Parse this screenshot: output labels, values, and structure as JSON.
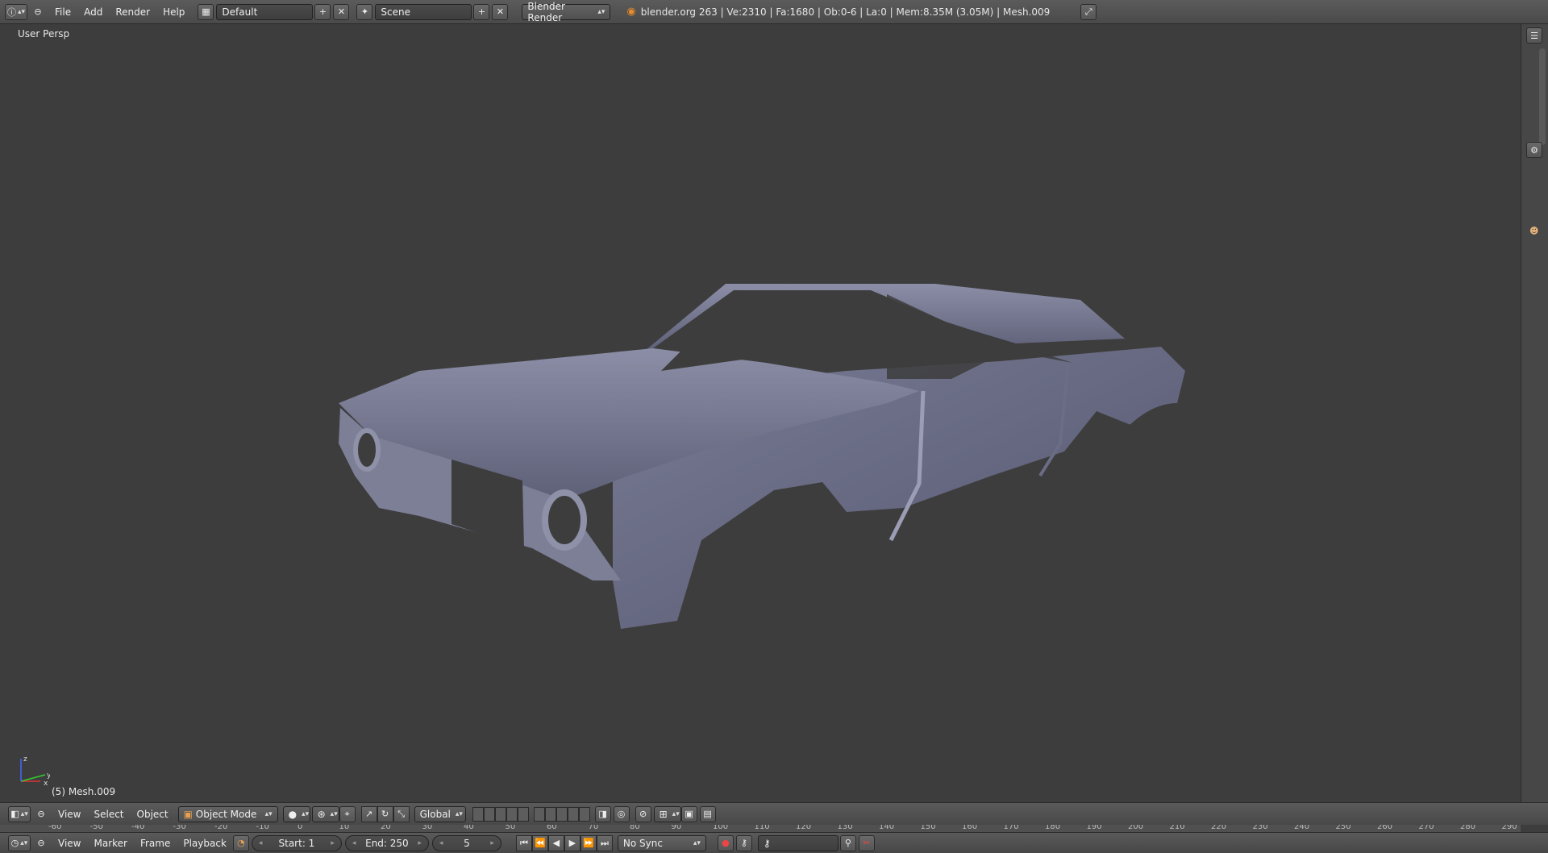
{
  "topbar": {
    "menus": [
      "File",
      "Add",
      "Render",
      "Help"
    ],
    "layout": "Default",
    "scene": "Scene",
    "engine": "Blender Render",
    "info": "blender.org 263 | Ve:2310 | Fa:1680 | Ob:0-6 | La:0 | Mem:8.35M (3.05M) | Mesh.009"
  },
  "viewport": {
    "view_label": "User Persp",
    "object_label": "(5) Mesh.009",
    "axis_x": "x",
    "axis_y": "y",
    "axis_z": "z",
    "model_color": "#7c7f96"
  },
  "view3d_header": {
    "menus": [
      "View",
      "Select",
      "Object"
    ],
    "mode": "Object Mode",
    "orientation": "Global"
  },
  "ruler": {
    "ticks": [
      "-60",
      "-50",
      "-40",
      "-30",
      "-20",
      "-10",
      "0",
      "10",
      "20",
      "30",
      "40",
      "50",
      "60",
      "70",
      "80",
      "90",
      "100",
      "110",
      "120",
      "130",
      "140",
      "150",
      "160",
      "170",
      "180",
      "190",
      "200",
      "210",
      "220",
      "230",
      "240",
      "250",
      "260",
      "270",
      "280",
      "290"
    ]
  },
  "timeline": {
    "menus": [
      "View",
      "Marker",
      "Frame",
      "Playback"
    ],
    "start": "Start: 1",
    "end": "End: 250",
    "current": "5",
    "sync": "No Sync"
  }
}
